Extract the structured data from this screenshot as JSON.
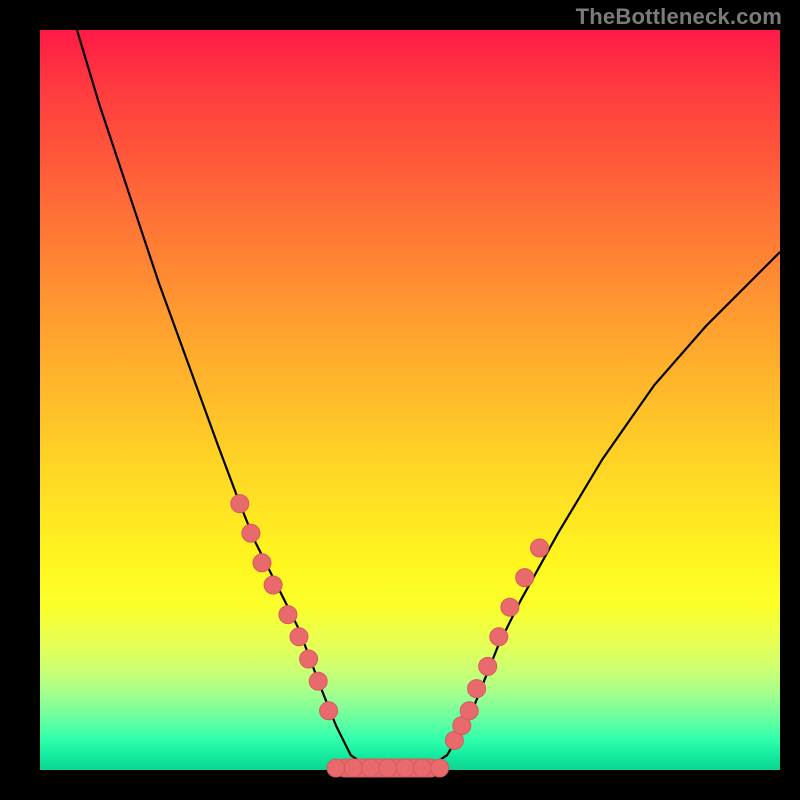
{
  "watermark": "TheBottleneck.com",
  "colors": {
    "background": "#000000",
    "curve": "#000000",
    "marker_fill": "#e86a6d",
    "marker_stroke": "#d45a5e",
    "gradient_top": "#ff1a46",
    "gradient_bottom": "#0fd492"
  },
  "chart_data": {
    "type": "line",
    "title": "",
    "xlabel": "",
    "ylabel": "",
    "xlim": [
      0,
      100
    ],
    "ylim": [
      0,
      100
    ],
    "series": [
      {
        "name": "bottleneck-curve",
        "x": [
          5,
          8,
          12,
          16,
          20,
          24,
          27,
          29,
          31,
          33,
          35,
          36.5,
          38,
          40,
          42,
          45,
          48,
          52,
          55,
          58,
          60,
          62,
          65,
          70,
          76,
          83,
          90,
          96,
          100
        ],
        "y": [
          100,
          90,
          78,
          66,
          55,
          44,
          36,
          31,
          27,
          23,
          19,
          15,
          11,
          6,
          2,
          0,
          0,
          0,
          2,
          7,
          12,
          17,
          23,
          32,
          42,
          52,
          60,
          66,
          70
        ]
      }
    ],
    "markers_left": [
      {
        "x": 27.0,
        "y": 36
      },
      {
        "x": 28.5,
        "y": 32
      },
      {
        "x": 30.0,
        "y": 28
      },
      {
        "x": 31.5,
        "y": 25
      },
      {
        "x": 33.5,
        "y": 21
      },
      {
        "x": 35.0,
        "y": 18
      },
      {
        "x": 36.3,
        "y": 15
      },
      {
        "x": 37.6,
        "y": 12
      },
      {
        "x": 39.0,
        "y": 8
      }
    ],
    "markers_right": [
      {
        "x": 56.0,
        "y": 4
      },
      {
        "x": 57.0,
        "y": 6
      },
      {
        "x": 58.0,
        "y": 8
      },
      {
        "x": 59.0,
        "y": 11
      },
      {
        "x": 60.5,
        "y": 14
      },
      {
        "x": 62.0,
        "y": 18
      },
      {
        "x": 63.5,
        "y": 22
      },
      {
        "x": 65.5,
        "y": 26
      },
      {
        "x": 67.5,
        "y": 30
      }
    ],
    "flat_segment": {
      "x_start": 40,
      "x_end": 54,
      "y": 0
    }
  }
}
